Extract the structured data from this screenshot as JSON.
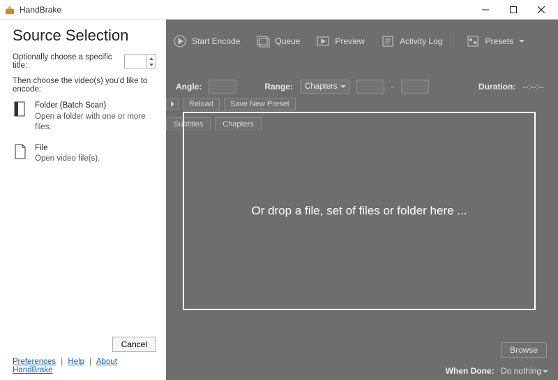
{
  "window": {
    "title": "HandBrake"
  },
  "toolbar": {
    "start_encode": "Start Encode",
    "queue": "Queue",
    "preview": "Preview",
    "activity_log": "Activity Log",
    "presets": "Presets"
  },
  "meta": {
    "angle_label": "Angle:",
    "range_label": "Range:",
    "range_mode": "Chapters",
    "duration_label": "Duration:",
    "duration_value": "--:--:--"
  },
  "minibar": {
    "reload": "Reload",
    "save_new_preset": "Save New Preset"
  },
  "tabs": {
    "subtitles": "Subtitles",
    "chapters": "Chapters"
  },
  "dropzone": {
    "text": "Or drop a file, set of files or folder here ..."
  },
  "browse": {
    "label": "Browse"
  },
  "when_done": {
    "label": "When Done:",
    "value": "Do nothing"
  },
  "source_panel": {
    "heading": "Source Selection",
    "optional_title_label": "Optionally choose a specific title:",
    "optional_title_value": "",
    "instruction": "Then choose the video(s) you'd like to encode:",
    "folder": {
      "title": "Folder (Batch Scan)",
      "desc": "Open a folder with one or more files."
    },
    "file": {
      "title": "File",
      "desc": "Open video file(s)."
    },
    "cancel": "Cancel",
    "links": {
      "preferences": "Preferences",
      "help": "Help",
      "about": "About HandBrake"
    }
  }
}
